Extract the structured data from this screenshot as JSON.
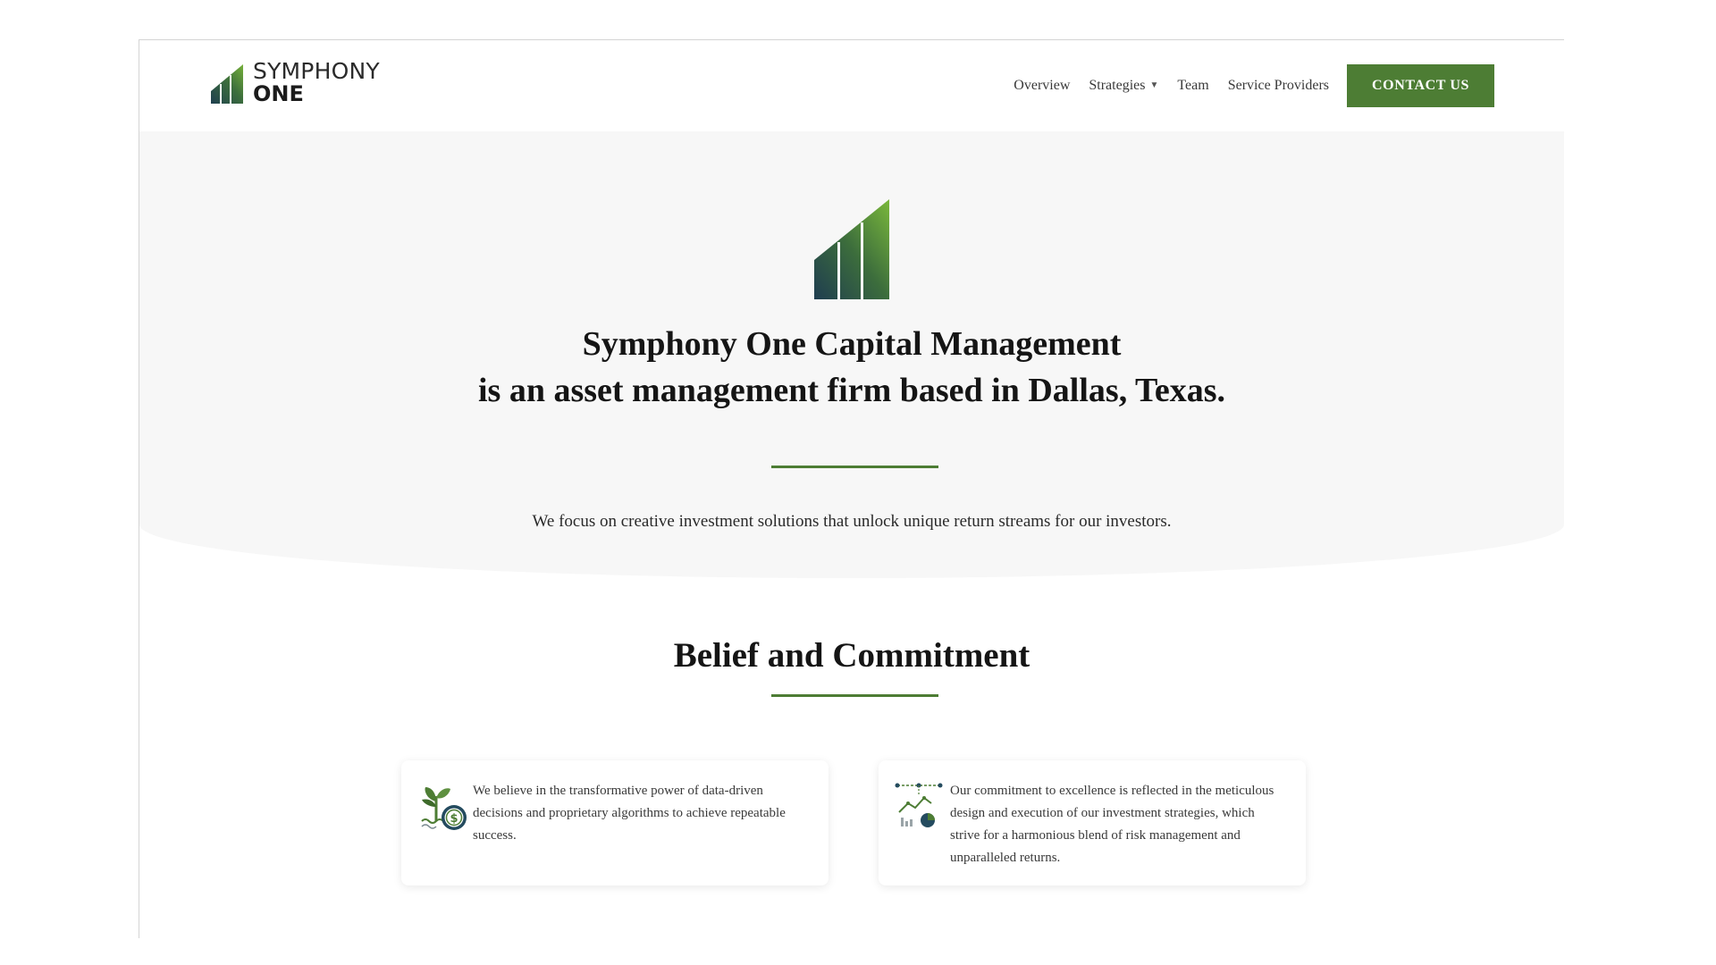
{
  "header": {
    "logo": {
      "line1": "SYMPHONY",
      "line2": "ONE"
    },
    "nav": {
      "overview": "Overview",
      "strategies": "Strategies",
      "team": "Team",
      "service_providers": "Service Providers",
      "contact": "CONTACT US"
    }
  },
  "hero": {
    "title_line1": "Symphony One Capital Management",
    "title_line2": "is an asset management firm based in Dallas, Texas.",
    "subtitle": "We focus on creative investment solutions that unlock unique return streams for our investors."
  },
  "belief": {
    "title": "Belief and Commitment",
    "cards": [
      {
        "icon": "plant-dollar-icon",
        "text": "We believe in the transformative power of data-driven decisions and proprietary algorithms to achieve repeatable success."
      },
      {
        "icon": "analytics-chart-icon",
        "text": "Our commitment to excellence is reflected in the meticulous design and execution of our investment strategies, which strive for a harmonious blend of risk management and unparalleled returns."
      }
    ]
  },
  "colors": {
    "brand_green": "#4d7d34",
    "hero_bg": "#f7f7f7"
  }
}
